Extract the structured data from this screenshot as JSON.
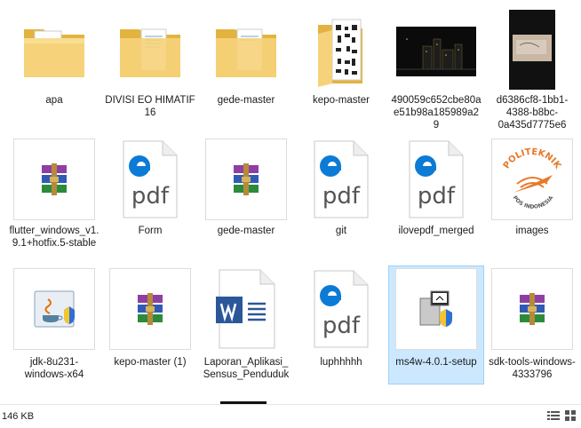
{
  "items": [
    {
      "label": "apa",
      "icon": "folder-icon"
    },
    {
      "label": "DIVISI EO HIMATIF 16",
      "icon": "folder-icon"
    },
    {
      "label": "gede-master",
      "icon": "folder-icon"
    },
    {
      "label": "kepo-master",
      "icon": "folder-icon"
    },
    {
      "label": "490059c652cbe80ae51b98a185989a29",
      "icon": "image-thumbnail-icon"
    },
    {
      "label": "d6386cf8-1bb1-4388-b8bc-0a435d7775e6",
      "icon": "image-thumbnail-icon"
    },
    {
      "label": "flutter_windows_v1.9.1+hotfix.5-stable",
      "icon": "winrar-archive-icon"
    },
    {
      "label": "Form",
      "icon": "edge-pdf-icon"
    },
    {
      "label": "gede-master",
      "icon": "winrar-archive-icon"
    },
    {
      "label": "git",
      "icon": "edge-pdf-icon"
    },
    {
      "label": "ilovepdf_merged",
      "icon": "edge-pdf-icon"
    },
    {
      "label": "images",
      "icon": "politeknik-logo-icon"
    },
    {
      "label": "jdk-8u231-windows-x64",
      "icon": "java-installer-icon"
    },
    {
      "label": "kepo-master (1)",
      "icon": "winrar-archive-icon"
    },
    {
      "label": "Laporan_Aplikasi_Sensus_Penduduk",
      "icon": "word-document-icon"
    },
    {
      "label": "luphhhhh",
      "icon": "edge-pdf-icon"
    },
    {
      "label": "ms4w-4.0.1-setup",
      "icon": "setup-installer-icon"
    },
    {
      "label": "sdk-tools-windows-4333796",
      "icon": "winrar-archive-icon"
    }
  ],
  "pdf_text": "pdf",
  "logo_text": {
    "top": "POLITEKNIK",
    "bottom": "POS INDONESIA"
  },
  "status_text": "146 KB",
  "colors": {
    "folder": "#f2c75c",
    "selection": "#cce8ff",
    "edge": "#0c7bd6",
    "word": "#2b579a",
    "java": "#e76f00"
  }
}
